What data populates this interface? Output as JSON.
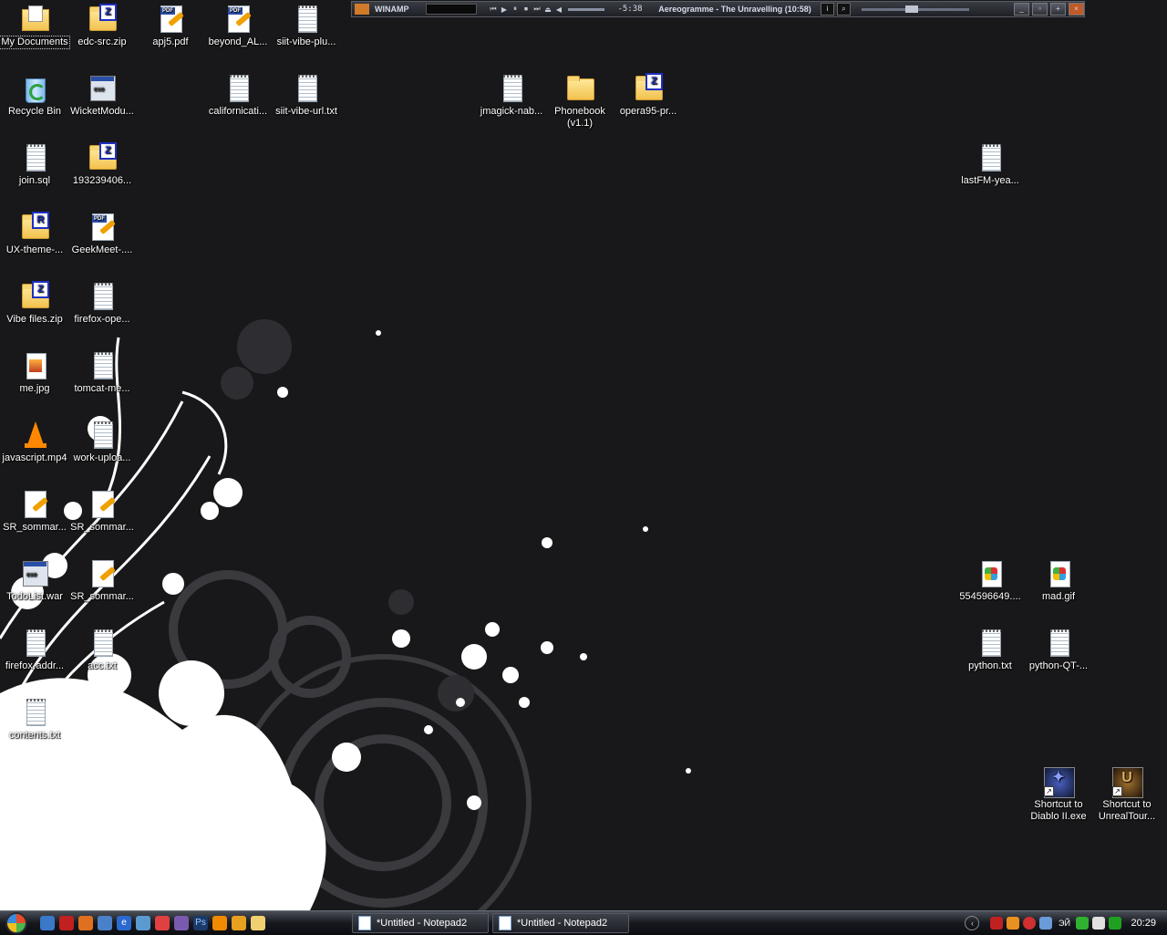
{
  "winamp": {
    "title": "WINAMP",
    "time": "-5:38",
    "track": "Aereogramme - The Unravelling (10:58)",
    "controls": [
      "⏮",
      "▶",
      "⏸",
      "⏹",
      "⏭"
    ]
  },
  "desktop": {
    "icons": [
      {
        "label": "My Documents",
        "type": "mydocs"
      },
      {
        "label": "edc-src.zip",
        "type": "zip"
      },
      {
        "label": "apj5.pdf",
        "type": "pdf"
      },
      {
        "label": "beyond_AL...",
        "type": "pdf"
      },
      {
        "label": "siit-vibe-plu...",
        "type": "doc"
      },
      {
        "label": "Recycle Bin",
        "type": "recycle"
      },
      {
        "label": "WicketModu...",
        "type": "exe"
      },
      {
        "label": "californicati...",
        "type": "doc"
      },
      {
        "label": "siit-vibe-url.txt",
        "type": "doc"
      },
      {
        "label": "jmagick-nab...",
        "type": "doc"
      },
      {
        "label": "Phonebook (v1.1)",
        "type": "folder"
      },
      {
        "label": "opera95-pr...",
        "type": "zip"
      },
      {
        "label": "join.sql",
        "type": "doc"
      },
      {
        "label": "193239406...",
        "type": "zip"
      },
      {
        "label": "lastFM-yea...",
        "type": "doc"
      },
      {
        "label": "UX-theme-...",
        "type": "rar"
      },
      {
        "label": "GeekMeet-....",
        "type": "pdf"
      },
      {
        "label": "Vibe files.zip",
        "type": "zip"
      },
      {
        "label": "firefox-ope...",
        "type": "doc"
      },
      {
        "label": "me.jpg",
        "type": "image"
      },
      {
        "label": "tomcat-me...",
        "type": "doc"
      },
      {
        "label": "javascript.mp4",
        "type": "vlc"
      },
      {
        "label": "work-uploa...",
        "type": "doc"
      },
      {
        "label": "SR_sommar...",
        "type": "pdf"
      },
      {
        "label": "SR_sommar...",
        "type": "pdf"
      },
      {
        "label": "TodoList.war",
        "type": "exe"
      },
      {
        "label": "SR_sommar...",
        "type": "pdf"
      },
      {
        "label": "firefox-addr...",
        "type": "doc"
      },
      {
        "label": "acc.txt",
        "type": "doc"
      },
      {
        "label": "contents.txt",
        "type": "doc"
      },
      {
        "label": "554596649....",
        "type": "gif"
      },
      {
        "label": "mad.gif",
        "type": "gif"
      },
      {
        "label": "python.txt",
        "type": "doc"
      },
      {
        "label": "python-QT-...",
        "type": "doc"
      },
      {
        "label": "Shortcut to Diablo II.exe",
        "type": "diablo"
      },
      {
        "label": "Shortcut to UnrealTour...",
        "type": "unreal"
      }
    ]
  },
  "taskbar": {
    "tasks": [
      {
        "label": "*Untitled - Notepad2"
      },
      {
        "label": "*Untitled - Notepad2"
      }
    ],
    "tray_lang": "ЭЙ",
    "clock": "20:29"
  }
}
